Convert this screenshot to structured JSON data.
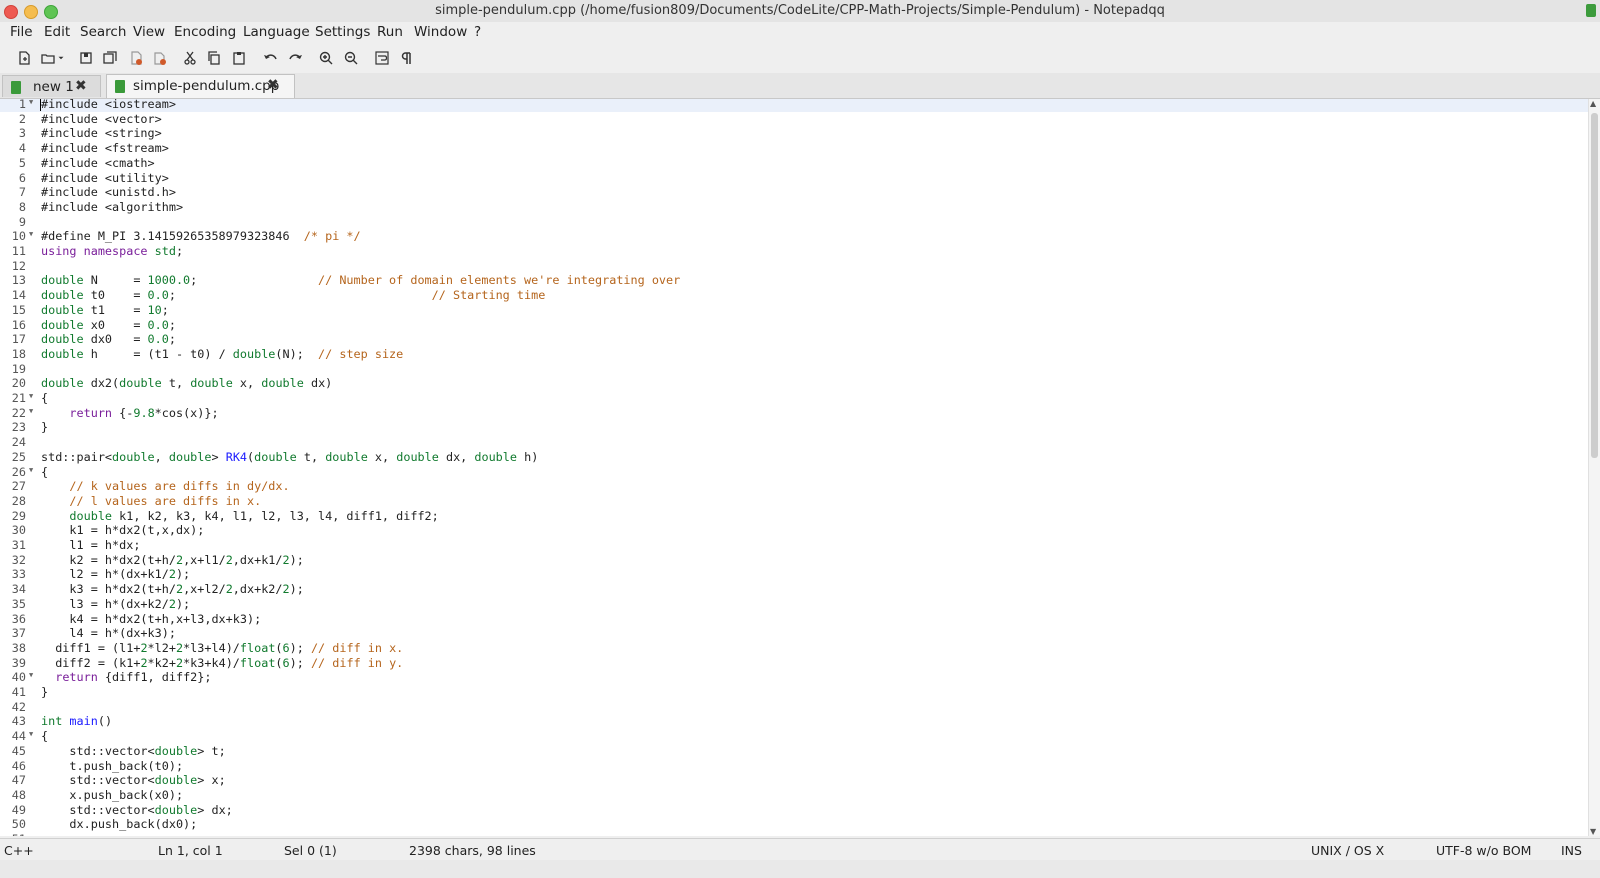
{
  "window": {
    "title": "simple-pendulum.cpp (/home/fusion809/Documents/CodeLite/CPP-Math-Projects/Simple-Pendulum) - Notepadqq"
  },
  "menu": [
    "File",
    "Edit",
    "Search",
    "View",
    "Encoding",
    "Language",
    "Settings",
    "Run",
    "Window",
    "?"
  ],
  "toolbar": [
    "new-file-icon",
    "open-file-icon",
    "open-dropdown-icon",
    "save-icon",
    "save-all-icon",
    "close-icon",
    "close-all-icon",
    "cut-icon",
    "copy-icon",
    "paste-icon",
    "undo-icon",
    "redo-icon",
    "zoom-in-icon",
    "zoom-out-icon",
    "word-wrap-icon",
    "show-all-chars-icon"
  ],
  "tabs": [
    {
      "label": "new 1",
      "active": false
    },
    {
      "label": "simple-pendulum.cpp",
      "active": true
    }
  ],
  "colors": {
    "keyword": "#7a1f9a",
    "type": "#117a2e",
    "number": "#117a2e",
    "comment": "#b5651d",
    "function": "#1a1aff",
    "current_line": "#eaf0fa"
  },
  "editor": {
    "lines": [
      {
        "n": "1",
        "fold": true,
        "tokens": [
          [
            "t",
            "#include <iostream>"
          ]
        ]
      },
      {
        "n": "2",
        "tokens": [
          [
            "t",
            "#include <vector>"
          ]
        ]
      },
      {
        "n": "3",
        "tokens": [
          [
            "t",
            "#include <string>"
          ]
        ]
      },
      {
        "n": "4",
        "tokens": [
          [
            "t",
            "#include <fstream>"
          ]
        ]
      },
      {
        "n": "5",
        "tokens": [
          [
            "t",
            "#include <cmath>"
          ]
        ]
      },
      {
        "n": "6",
        "tokens": [
          [
            "t",
            "#include <utility>"
          ]
        ]
      },
      {
        "n": "7",
        "tokens": [
          [
            "t",
            "#include <unistd.h>"
          ]
        ]
      },
      {
        "n": "8",
        "tokens": [
          [
            "t",
            "#include <algorithm>"
          ]
        ]
      },
      {
        "n": "9",
        "tokens": []
      },
      {
        "n": "10",
        "fold": true,
        "tokens": [
          [
            "t",
            "#define M_PI 3.14159265358979323846  "
          ],
          [
            "c",
            "/* pi */"
          ]
        ]
      },
      {
        "n": "11",
        "tokens": [
          [
            "k",
            "using namespace "
          ],
          [
            "g",
            "std"
          ],
          [
            "t",
            ";"
          ]
        ]
      },
      {
        "n": "12",
        "tokens": []
      },
      {
        "n": "13",
        "tokens": [
          [
            "g",
            "double"
          ],
          [
            "t",
            " N     = "
          ],
          [
            "g",
            "1000.0"
          ],
          [
            "t",
            ";                 "
          ],
          [
            "c",
            "// Number of domain elements we're integrating over"
          ]
        ]
      },
      {
        "n": "14",
        "tokens": [
          [
            "g",
            "double"
          ],
          [
            "t",
            " t0    = "
          ],
          [
            "g",
            "0.0"
          ],
          [
            "t",
            ";                                    "
          ],
          [
            "c",
            "// Starting time"
          ]
        ]
      },
      {
        "n": "15",
        "tokens": [
          [
            "g",
            "double"
          ],
          [
            "t",
            " t1    = "
          ],
          [
            "g",
            "10"
          ],
          [
            "t",
            ";"
          ]
        ]
      },
      {
        "n": "16",
        "tokens": [
          [
            "g",
            "double"
          ],
          [
            "t",
            " x0    = "
          ],
          [
            "g",
            "0.0"
          ],
          [
            "t",
            ";"
          ]
        ]
      },
      {
        "n": "17",
        "tokens": [
          [
            "g",
            "double"
          ],
          [
            "t",
            " dx0   = "
          ],
          [
            "g",
            "0.0"
          ],
          [
            "t",
            ";"
          ]
        ]
      },
      {
        "n": "18",
        "tokens": [
          [
            "g",
            "double"
          ],
          [
            "t",
            " h     = (t1 - t0) / "
          ],
          [
            "g",
            "double"
          ],
          [
            "t",
            "(N);  "
          ],
          [
            "c",
            "// step size"
          ]
        ]
      },
      {
        "n": "19",
        "tokens": []
      },
      {
        "n": "20",
        "tokens": [
          [
            "g",
            "double"
          ],
          [
            "t",
            " dx2("
          ],
          [
            "g",
            "double"
          ],
          [
            "t",
            " t, "
          ],
          [
            "g",
            "double"
          ],
          [
            "t",
            " x, "
          ],
          [
            "g",
            "double"
          ],
          [
            "t",
            " dx)"
          ]
        ]
      },
      {
        "n": "21",
        "fold": true,
        "tokens": [
          [
            "t",
            "{"
          ]
        ]
      },
      {
        "n": "22",
        "fold": true,
        "tokens": [
          [
            "t",
            "    "
          ],
          [
            "k",
            "return"
          ],
          [
            "t",
            " {-"
          ],
          [
            "g",
            "9.8"
          ],
          [
            "t",
            "*cos(x)};"
          ]
        ]
      },
      {
        "n": "23",
        "tokens": [
          [
            "t",
            "}"
          ]
        ]
      },
      {
        "n": "24",
        "tokens": []
      },
      {
        "n": "25",
        "tokens": [
          [
            "t",
            "std::pair<"
          ],
          [
            "g",
            "double"
          ],
          [
            "t",
            ", "
          ],
          [
            "g",
            "double"
          ],
          [
            "t",
            "> "
          ],
          [
            "f",
            "RK4"
          ],
          [
            "t",
            "("
          ],
          [
            "g",
            "double"
          ],
          [
            "t",
            " t, "
          ],
          [
            "g",
            "double"
          ],
          [
            "t",
            " x, "
          ],
          [
            "g",
            "double"
          ],
          [
            "t",
            " dx, "
          ],
          [
            "g",
            "double"
          ],
          [
            "t",
            " h)"
          ]
        ]
      },
      {
        "n": "26",
        "fold": true,
        "tokens": [
          [
            "t",
            "{"
          ]
        ]
      },
      {
        "n": "27",
        "tokens": [
          [
            "t",
            "    "
          ],
          [
            "c",
            "// k values are diffs in dy/dx."
          ]
        ]
      },
      {
        "n": "28",
        "tokens": [
          [
            "t",
            "    "
          ],
          [
            "c",
            "// l values are diffs in x."
          ]
        ]
      },
      {
        "n": "29",
        "tokens": [
          [
            "t",
            "    "
          ],
          [
            "g",
            "double"
          ],
          [
            "t",
            " k1, k2, k3, k4, l1, l2, l3, l4, diff1, diff2;"
          ]
        ]
      },
      {
        "n": "30",
        "tokens": [
          [
            "t",
            "    k1 = h*dx2(t,x,dx);"
          ]
        ]
      },
      {
        "n": "31",
        "tokens": [
          [
            "t",
            "    l1 = h*dx;"
          ]
        ]
      },
      {
        "n": "32",
        "tokens": [
          [
            "t",
            "    k2 = h*dx2(t+h/"
          ],
          [
            "g",
            "2"
          ],
          [
            "t",
            ",x+l1/"
          ],
          [
            "g",
            "2"
          ],
          [
            "t",
            ",dx+k1/"
          ],
          [
            "g",
            "2"
          ],
          [
            "t",
            ");"
          ]
        ]
      },
      {
        "n": "33",
        "tokens": [
          [
            "t",
            "    l2 = h*(dx+k1/"
          ],
          [
            "g",
            "2"
          ],
          [
            "t",
            ");"
          ]
        ]
      },
      {
        "n": "34",
        "tokens": [
          [
            "t",
            "    k3 = h*dx2(t+h/"
          ],
          [
            "g",
            "2"
          ],
          [
            "t",
            ",x+l2/"
          ],
          [
            "g",
            "2"
          ],
          [
            "t",
            ",dx+k2/"
          ],
          [
            "g",
            "2"
          ],
          [
            "t",
            ");"
          ]
        ]
      },
      {
        "n": "35",
        "tokens": [
          [
            "t",
            "    l3 = h*(dx+k2/"
          ],
          [
            "g",
            "2"
          ],
          [
            "t",
            ");"
          ]
        ]
      },
      {
        "n": "36",
        "tokens": [
          [
            "t",
            "    k4 = h*dx2(t+h,x+l3,dx+k3);"
          ]
        ]
      },
      {
        "n": "37",
        "tokens": [
          [
            "t",
            "    l4 = h*(dx+k3);"
          ]
        ]
      },
      {
        "n": "38",
        "tokens": [
          [
            "t",
            "  diff1 = (l1+"
          ],
          [
            "g",
            "2"
          ],
          [
            "t",
            "*l2+"
          ],
          [
            "g",
            "2"
          ],
          [
            "t",
            "*l3+l4)/"
          ],
          [
            "g",
            "float"
          ],
          [
            "t",
            "("
          ],
          [
            "g",
            "6"
          ],
          [
            "t",
            "); "
          ],
          [
            "c",
            "// diff in x."
          ]
        ]
      },
      {
        "n": "39",
        "tokens": [
          [
            "t",
            "  diff2 = (k1+"
          ],
          [
            "g",
            "2"
          ],
          [
            "t",
            "*k2+"
          ],
          [
            "g",
            "2"
          ],
          [
            "t",
            "*k3+k4)/"
          ],
          [
            "g",
            "float"
          ],
          [
            "t",
            "("
          ],
          [
            "g",
            "6"
          ],
          [
            "t",
            "); "
          ],
          [
            "c",
            "// diff in y."
          ]
        ]
      },
      {
        "n": "40",
        "fold": true,
        "tokens": [
          [
            "t",
            "  "
          ],
          [
            "k",
            "return"
          ],
          [
            "t",
            " {diff1, diff2};"
          ]
        ]
      },
      {
        "n": "41",
        "tokens": [
          [
            "t",
            "}"
          ]
        ]
      },
      {
        "n": "42",
        "tokens": []
      },
      {
        "n": "43",
        "tokens": [
          [
            "g",
            "int"
          ],
          [
            "t",
            " "
          ],
          [
            "f",
            "main"
          ],
          [
            "t",
            "()"
          ]
        ]
      },
      {
        "n": "44",
        "fold": true,
        "tokens": [
          [
            "t",
            "{"
          ]
        ]
      },
      {
        "n": "45",
        "tokens": [
          [
            "t",
            "    std::vector<"
          ],
          [
            "g",
            "double"
          ],
          [
            "t",
            "> t;"
          ]
        ]
      },
      {
        "n": "46",
        "tokens": [
          [
            "t",
            "    t.push_back(t0);"
          ]
        ]
      },
      {
        "n": "47",
        "tokens": [
          [
            "t",
            "    std::vector<"
          ],
          [
            "g",
            "double"
          ],
          [
            "t",
            "> x;"
          ]
        ]
      },
      {
        "n": "48",
        "tokens": [
          [
            "t",
            "    x.push_back(x0);"
          ]
        ]
      },
      {
        "n": "49",
        "tokens": [
          [
            "t",
            "    std::vector<"
          ],
          [
            "g",
            "double"
          ],
          [
            "t",
            "> dx;"
          ]
        ]
      },
      {
        "n": "50",
        "tokens": [
          [
            "t",
            "    dx.push_back(dx0);"
          ]
        ]
      },
      {
        "n": "51",
        "tokens": []
      }
    ]
  },
  "status": {
    "language": "C++",
    "position": "Ln 1, col 1",
    "selection": "Sel 0 (1)",
    "stats": "2398 chars, 98 lines",
    "eol": "UNIX / OS X",
    "encoding": "UTF-8 w/o BOM",
    "mode": "INS"
  }
}
